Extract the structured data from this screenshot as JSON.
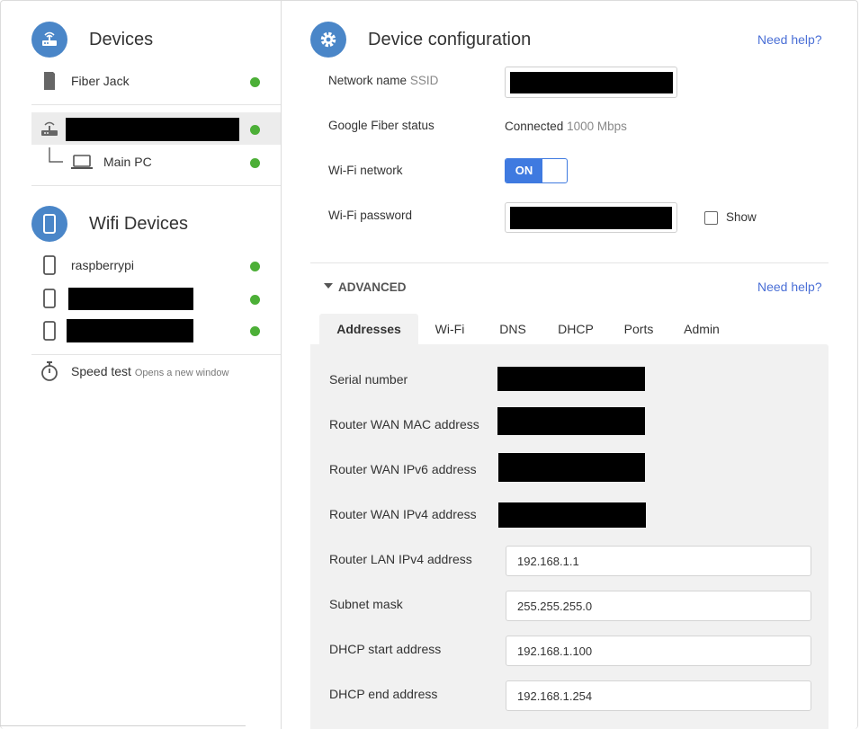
{
  "devices": {
    "title": "Devices",
    "fiber_jack": "Fiber Jack",
    "router_name": "",
    "main_pc": "Main PC"
  },
  "wifi_devices": {
    "title": "Wifi Devices",
    "items": [
      "raspberrypi",
      "",
      ""
    ]
  },
  "speed_test": {
    "label": "Speed test",
    "note": "Opens a new window"
  },
  "config": {
    "title": "Device configuration",
    "need_help": "Need help?",
    "ssid_label": "Network name",
    "ssid_suffix": "SSID",
    "fiber_status_label": "Google Fiber status",
    "fiber_status_value": "Connected",
    "fiber_speed": "1000 Mbps",
    "wifi_network_label": "Wi-Fi network",
    "wifi_toggle": "ON",
    "wifi_password_label": "Wi-Fi password",
    "show_label": "Show"
  },
  "advanced": {
    "label": "ADVANCED",
    "need_help": "Need help?",
    "tabs": [
      "Addresses",
      "Wi-Fi",
      "DNS",
      "DHCP",
      "Ports",
      "Admin"
    ],
    "fields": {
      "serial_label": "Serial number",
      "wan_mac_label": "Router WAN MAC address",
      "wan_ipv6_label": "Router WAN IPv6 address",
      "wan_ipv4_label": "Router WAN IPv4 address",
      "lan_ipv4_label": "Router LAN IPv4 address",
      "lan_ipv4_value": "192.168.1.1",
      "subnet_label": "Subnet mask",
      "subnet_value": "255.255.255.0",
      "dhcp_start_label": "DHCP start address",
      "dhcp_start_value": "192.168.1.100",
      "dhcp_end_label": "DHCP end address",
      "dhcp_end_value": "192.168.1.254"
    }
  },
  "colors": {
    "accent": "#4a86c8",
    "link": "#4a6fd6",
    "toggle": "#3f7ae0",
    "status_dot": "#4caf37"
  }
}
